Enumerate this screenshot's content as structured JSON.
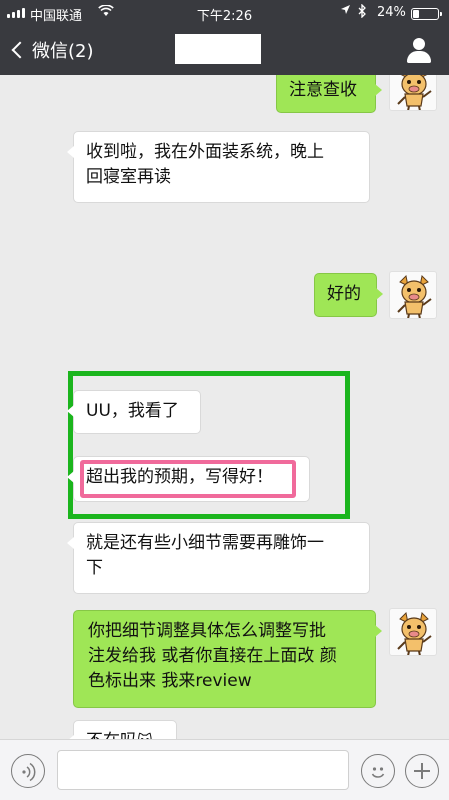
{
  "status_bar": {
    "carrier": "中国联通",
    "time": "下午2:26",
    "battery_text": "24%",
    "battery_level": 0.24,
    "icons": [
      "signal-icon",
      "wifi-icon",
      "location-icon",
      "bluetooth-icon",
      "battery-icon"
    ]
  },
  "nav": {
    "back_label": "微信(2)",
    "icons": [
      "back-chevron-icon",
      "person-icon"
    ]
  },
  "messages": [
    {
      "side": "right",
      "text": "注意查收"
    },
    {
      "side": "left",
      "lines": [
        "收到啦，我在外面装系统，晚上",
        "回寝室再读"
      ]
    },
    {
      "side": "right",
      "text": "好的"
    },
    {
      "side": "left",
      "text": "UU，我看了"
    },
    {
      "side": "left",
      "text": "超出我的预期，写得好！"
    },
    {
      "side": "left",
      "lines": [
        "就是还有些小细节需要再雕饰一",
        "下"
      ]
    },
    {
      "side": "right",
      "lines": [
        "你把细节调整具体怎么调整写批",
        "注发给我 或者你直接在上面改 颜",
        "色标出来 我来review"
      ]
    },
    {
      "side": "left",
      "text": "不在吗"
    }
  ],
  "input_bar": {
    "icons": [
      "voice-icon",
      "emoji-icon",
      "plus-icon"
    ]
  },
  "colors": {
    "nav_bg": "#393a3f",
    "chat_bg": "#ebebeb",
    "sent_bubble": "#9fe656",
    "highlight_green": "#1bb51d",
    "highlight_pink": "#f06a9b"
  }
}
